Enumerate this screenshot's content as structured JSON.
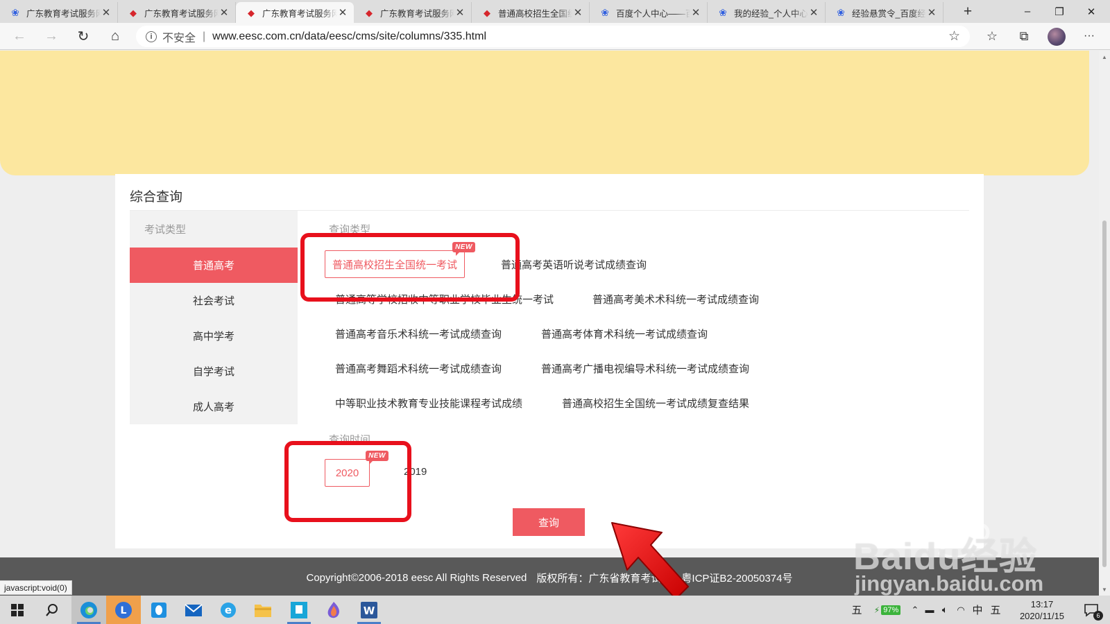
{
  "browser": {
    "tabs": [
      {
        "title": "广东教育考试服务网",
        "icon": "baidu-paw-icon",
        "active": false
      },
      {
        "title": "广东教育考试服务网",
        "icon": "eesc-logo-icon",
        "active": false
      },
      {
        "title": "广东教育考试服务网",
        "icon": "eesc-logo-icon",
        "active": true
      },
      {
        "title": "广东教育考试服务网",
        "icon": "eesc-logo-icon",
        "active": false
      },
      {
        "title": "普通高校招生全国统一考试",
        "icon": "eesc-logo-icon",
        "active": false
      },
      {
        "title": "百度个人中心——百度经验",
        "icon": "baidu-paw-icon",
        "active": false
      },
      {
        "title": "我的经验_个人中心_百度经验",
        "icon": "baidu-paw-icon",
        "active": false
      },
      {
        "title": "经验悬赏令_百度经验",
        "icon": "baidu-paw-icon",
        "active": false
      }
    ],
    "new_tab": "+",
    "window_controls": {
      "minimize": "–",
      "restore": "❐",
      "close": "✕"
    },
    "address": {
      "security_label": "不安全",
      "separator": "|",
      "url": "www.eesc.com.cn/data/eesc/cms/site/columns/335.html"
    },
    "nav": {
      "back": "←",
      "forward": "→",
      "reload": "↻",
      "home": "⌂",
      "favorite": "☆",
      "favorites": "☆",
      "collections": "⧉",
      "more": "···"
    },
    "status_url": "javascript:void(0)"
  },
  "page": {
    "panel_title": "综合查询",
    "exam_type_label": "考试类型",
    "exam_types": [
      {
        "label": "普通高考",
        "selected": true
      },
      {
        "label": "社会考试",
        "selected": false
      },
      {
        "label": "高中学考",
        "selected": false
      },
      {
        "label": "自学考试",
        "selected": false
      },
      {
        "label": "成人高考",
        "selected": false
      }
    ],
    "query_type_label": "查询类型",
    "query_types": [
      {
        "label": "普通高校招生全国统一考试",
        "selected": true,
        "new": true
      },
      {
        "label": "普通高考英语听说考试成绩查询"
      },
      {
        "label": "普通高等学校招收中等职业学校毕业生统一考试"
      },
      {
        "label": "普通高考美术术科统一考试成绩查询"
      },
      {
        "label": "普通高考音乐术科统一考试成绩查询"
      },
      {
        "label": "普通高考体育术科统一考试成绩查询"
      },
      {
        "label": "普通高考舞蹈术科统一考试成绩查询"
      },
      {
        "label": "普通高考广播电视编导术科统一考试成绩查询"
      },
      {
        "label": "中等职业技术教育专业技能课程考试成绩"
      },
      {
        "label": "普通高校招生全国统一考试成绩复查结果"
      }
    ],
    "query_time_label": "查询时间",
    "years": [
      {
        "label": "2020",
        "selected": true,
        "new": true
      },
      {
        "label": "2019"
      }
    ],
    "new_badge": "NEW",
    "query_button": "查询",
    "footer": {
      "copyright": "Copyright©2006-2018 eesc All Rights Reserved",
      "owner": "版权所有：广东省教育考试院",
      "icp": "粤ICP证B2-20050374号"
    },
    "accent_color": "#ef5a61",
    "highlight_color": "#e8101c"
  },
  "watermark": {
    "brand": "Baidu经验",
    "url": "jingyan.baidu.com"
  },
  "taskbar": {
    "apps": [
      "windows-start-icon",
      "search-icon",
      "edge-icon",
      "lenovo-icon",
      "qq-icon",
      "mail-icon",
      "ie-icon",
      "file-explorer-icon",
      "screenshot-app-icon",
      "photos-icon",
      "word-icon"
    ],
    "tray": {
      "ime_mode": "五",
      "battery": "97%",
      "language": "中",
      "ime_mode_2": "五",
      "time": "13:17",
      "date": "2020/11/15",
      "notifications": "6"
    }
  }
}
